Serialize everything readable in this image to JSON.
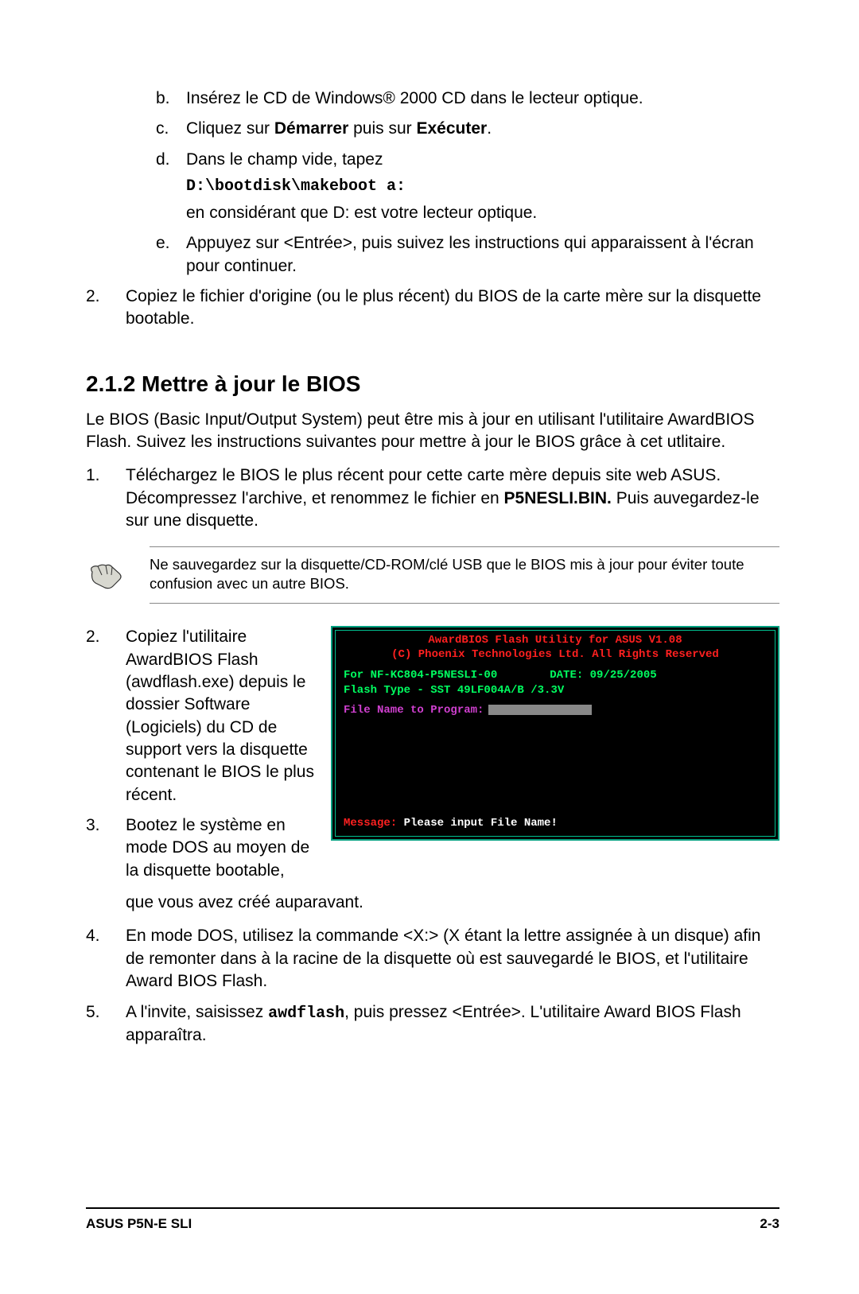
{
  "steps_top": {
    "b": {
      "marker": "b.",
      "text": "Insérez le CD de Windows® 2000 CD dans le lecteur optique."
    },
    "c": {
      "marker": "c.",
      "pre": "Cliquez sur ",
      "bold1": "Démarrer",
      "mid": " puis sur ",
      "bold2": "Exécuter",
      "post": "."
    },
    "d": {
      "marker": "d.",
      "line1": "Dans le champ vide, tapez",
      "cmd": "D:\\bootdisk\\makeboot a:",
      "line3": "en considérant que D: est votre lecteur optique."
    },
    "e": {
      "marker": "e.",
      "text": "Appuyez sur <Entrée>, puis suivez les instructions qui apparaissent à l'écran pour continuer."
    }
  },
  "step2_top": {
    "marker": "2.",
    "text": "Copiez le fichier d'origine (ou le plus récent) du BIOS de la carte mère sur la disquette bootable."
  },
  "heading": "2.1.2   Mettre à jour le BIOS",
  "intro": "Le BIOS (Basic Input/Output System) peut être mis à jour en utilisant l'utilitaire AwardBIOS Flash. Suivez les instructions suivantes pour mettre à jour le BIOS grâce à cet utlitaire.",
  "list_main": {
    "s1": {
      "marker": "1.",
      "pre": "Téléchargez le BIOS le plus récent pour cette carte mère depuis site web ASUS. Décompressez l'archive, et renommez le fichier en ",
      "bold": "P5NESLI.BIN.",
      "post": " Puis auvegardez-le sur une disquette."
    },
    "note": "Ne sauvegardez sur la disquette/CD-ROM/clé USB que le BIOS mis à jour pour éviter toute confusion avec un autre BIOS.",
    "s2": {
      "marker": "2.",
      "text": "Copiez l'utilitaire AwardBIOS Flash (awdflash.exe) depuis le dossier Software (Logiciels) du CD de support vers la disquette contenant le BIOS le plus récent."
    },
    "s3": {
      "marker": "3.",
      "text_left": "Bootez le système en mode DOS au moyen de la disquette bootable,",
      "text_below": " que vous avez créé auparavant."
    },
    "s4": {
      "marker": "4.",
      "text": "En mode DOS, utilisez la commande <X:> (X étant la lettre assignée à un disque) afin de remonter dans à la racine de la disquette où est sauvegardé le BIOS, et l'utilitaire Award BIOS Flash."
    },
    "s5": {
      "marker": "5.",
      "pre": "A l'invite, saisissez ",
      "bold": "awdflash",
      "post": ", puis pressez <Entrée>. L'utilitaire Award BIOS Flash apparaîtra."
    }
  },
  "bios": {
    "header1": "AwardBIOS Flash Utility for ASUS V1.08",
    "header2": "(C) Phoenix Technologies Ltd. All Rights Reserved",
    "line1a": "For NF-KC804-P5NESLI-00",
    "line1b": "DATE: 09/25/2005",
    "line2": "Flash Type - SST 49LF004A/B /3.3V",
    "prompt": "File Name to Program:",
    "msg_label": "Message:",
    "msg_text": " Please input File Name!"
  },
  "footer": {
    "left": "ASUS P5N-E SLI",
    "right": "2-3"
  }
}
